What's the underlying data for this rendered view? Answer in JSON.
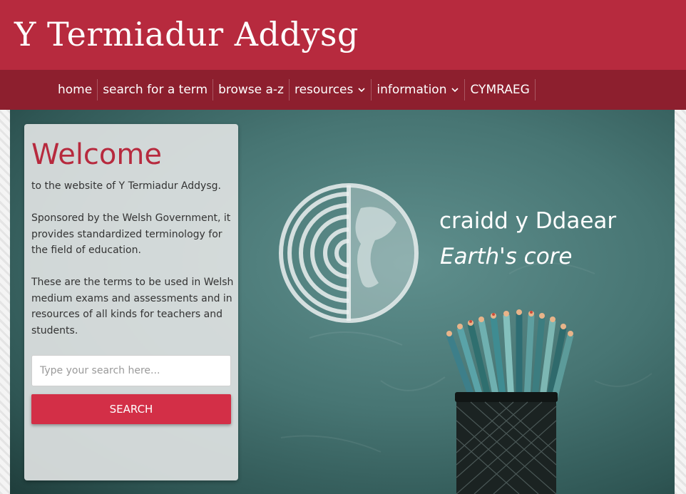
{
  "header": {
    "site_title": "Y Termiadur Addysg"
  },
  "nav": {
    "items": [
      {
        "label": "home",
        "has_dropdown": false
      },
      {
        "label": "search for a term",
        "has_dropdown": false
      },
      {
        "label": "browse a-z",
        "has_dropdown": false
      },
      {
        "label": "resources",
        "has_dropdown": true
      },
      {
        "label": "information",
        "has_dropdown": true
      },
      {
        "label": "CYMRAEG",
        "has_dropdown": false
      }
    ]
  },
  "welcome": {
    "title": "Welcome",
    "intro": "to the website of Y Termiadur Addysg.",
    "paragraph_1": "Sponsored by the Welsh Government, it provides standardized terminology for the field of education.",
    "paragraph_2": "These are the terms to be used in Welsh medium exams and assessments and in resources of all kinds for teachers and students.",
    "search_placeholder": "Type your search here...",
    "search_button": "SEARCH"
  },
  "hero": {
    "term_welsh": "craidd y Ddaear",
    "term_english": "Earth's core",
    "illustration_icon": "earth-core-icon",
    "image": "pencil-cup-on-chalkboard"
  },
  "colors": {
    "brand_red": "#b72a3e",
    "nav_dark_red": "#8d1f2e",
    "button_red": "#d32f47",
    "chalkboard": "#477573"
  }
}
